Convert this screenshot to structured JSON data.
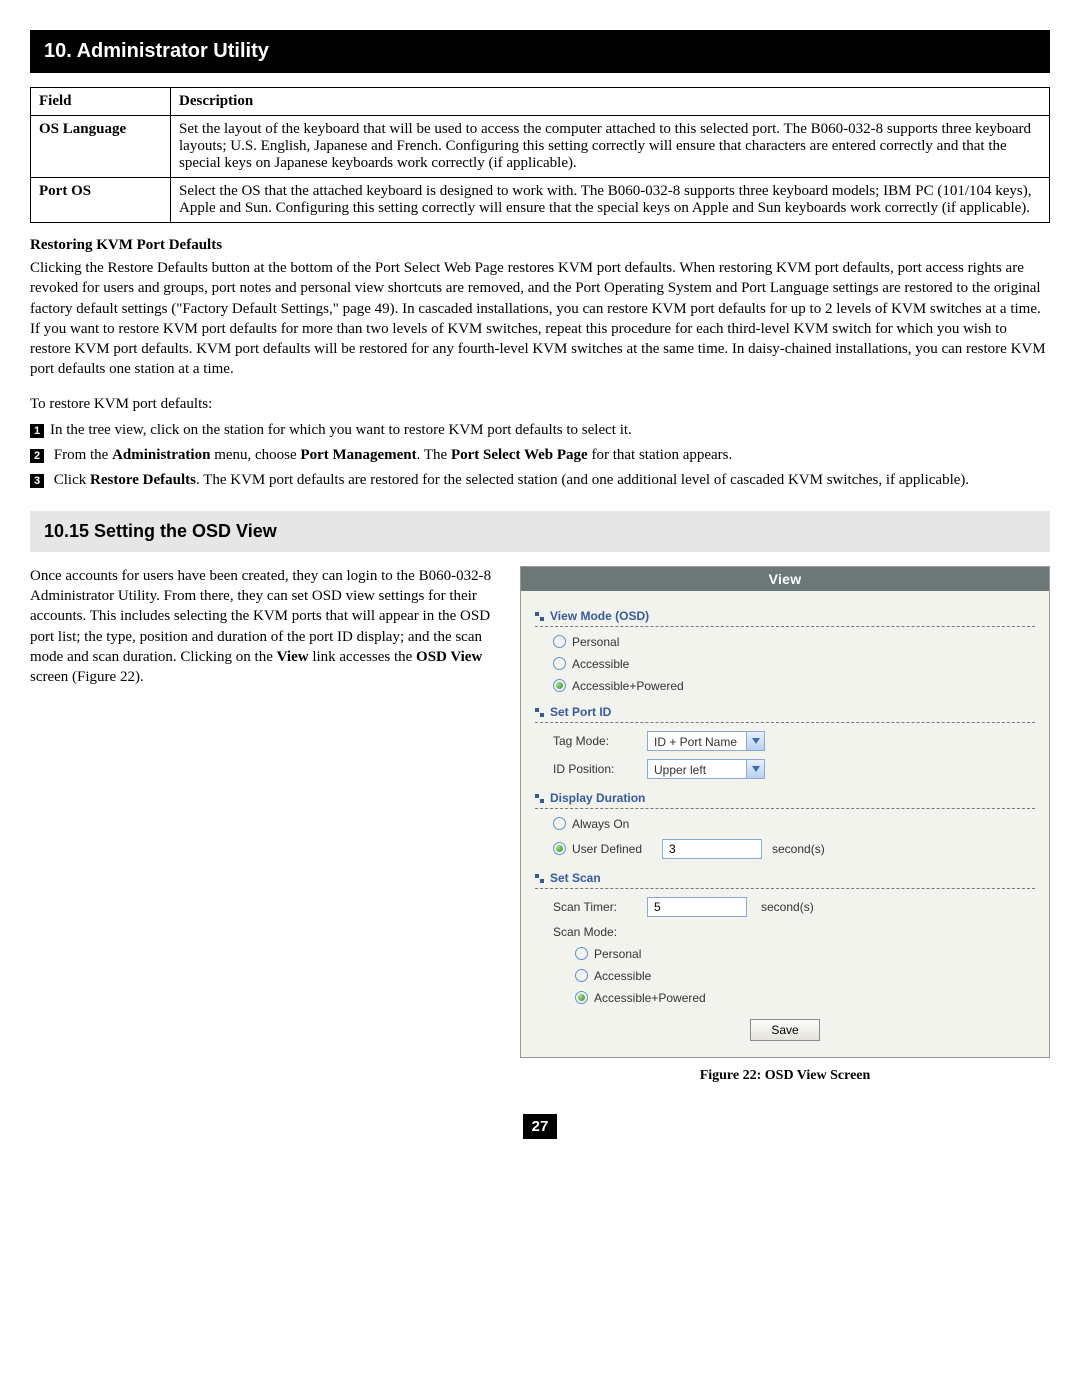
{
  "chapter_title": "10. Administrator Utility",
  "table": {
    "headers": [
      "Field",
      "Description"
    ],
    "rows": [
      {
        "field": "OS Language",
        "desc": "Set the layout of the keyboard that will be used to access the computer attached to this selected port. The B060-032-8 supports three keyboard layouts; U.S. English, Japanese and French. Configuring this setting correctly will ensure that characters are entered correctly and that the special keys on Japanese keyboards work correctly (if applicable)."
      },
      {
        "field": "Port OS",
        "desc": "Select the OS that the attached keyboard is designed to work with. The B060-032-8 supports three keyboard models; IBM PC (101/104 keys), Apple and Sun. Configuring this setting correctly will ensure that the special keys on Apple and Sun keyboards work correctly (if applicable)."
      }
    ]
  },
  "restore": {
    "heading": "Restoring KVM Port Defaults",
    "para": "Clicking the Restore Defaults button at the bottom of the Port Select Web Page restores KVM port defaults. When restoring KVM port defaults, port access rights are revoked for users and groups, port notes and personal view shortcuts are removed, and the Port Operating System and Port Language settings are restored to the original factory default settings (\"Factory Default Settings,\" page 49). In cascaded installations, you can restore KVM port defaults for up to 2 levels of KVM switches at a time. If you want to restore KVM port defaults for more than two levels of KVM switches, repeat this procedure for each third-level KVM switch for which you wish to restore KVM port defaults. KVM port defaults will be restored for any fourth-level KVM switches at the same time. In daisy-chained installations, you can restore KVM port defaults one station at a time.",
    "lead": "To restore KVM port defaults:",
    "steps": {
      "s1": "In the tree view, click on the station for which you want to restore KVM port defaults to select it.",
      "s2a": "From the ",
      "s2b": "Administration",
      "s2c": " menu, choose ",
      "s2d": "Port Management",
      "s2e": ". The ",
      "s2f": "Port Select Web Page",
      "s2g": " for that station appears.",
      "s3a": "Click ",
      "s3b": "Restore Defaults",
      "s3c": ". The KVM port defaults are restored for the selected station (and one additional level of cascaded KVM switches, if applicable)."
    }
  },
  "section_title": "10.15 Setting the OSD View",
  "osd_text": {
    "p1a": "Once accounts for users have been created, they can login to the B060-032-8 Administrator Utility. From there, they can set OSD view settings for their accounts. This includes selecting the KVM ports that will appear in the OSD port list; the type, position and duration of the port ID display; and the scan mode and scan duration. Clicking on the ",
    "p1b": "View",
    "p1c": " link accesses the ",
    "p1d": "OSD View",
    "p1e": " screen (Figure 22)."
  },
  "panel": {
    "title": "View",
    "view_mode": {
      "heading": "View Mode (OSD)",
      "options": [
        "Personal",
        "Accessible",
        "Accessible+Powered"
      ],
      "selected": 2
    },
    "set_port_id": {
      "heading": "Set Port ID",
      "tag_mode_label": "Tag Mode:",
      "tag_mode_value": "ID + Port Name",
      "id_pos_label": "ID Position:",
      "id_pos_value": "Upper left"
    },
    "display_duration": {
      "heading": "Display Duration",
      "always_on": "Always On",
      "user_defined": "User Defined",
      "value": "3",
      "unit": "second(s)",
      "selected": 1
    },
    "set_scan": {
      "heading": "Set Scan",
      "scan_timer_label": "Scan Timer:",
      "scan_timer_value": "5",
      "unit": "second(s)",
      "scan_mode_label": "Scan Mode:",
      "options": [
        "Personal",
        "Accessible",
        "Accessible+Powered"
      ],
      "selected": 2
    },
    "save_label": "Save"
  },
  "figure_caption": "Figure 22: OSD View Screen",
  "page_number": "27"
}
